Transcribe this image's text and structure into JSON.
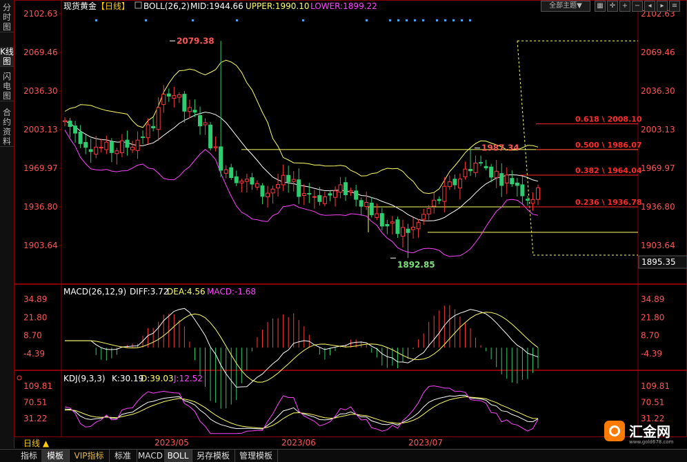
{
  "sidebar": {
    "tabs": [
      {
        "label": "分时图",
        "active": false
      },
      {
        "label": "K线图",
        "active": true
      },
      {
        "label": "闪电图",
        "active": false
      },
      {
        "label": "合约资料",
        "active": false
      }
    ]
  },
  "header": {
    "title": "现货黄金",
    "period": "【日线】",
    "boll_label": "BOLL(26,2)",
    "mid": "MID:1944.66",
    "upper": "UPPER:1990.10",
    "lower": "LOWER:1899.22",
    "theme_select": "全部主题▼"
  },
  "colors": {
    "up": "#ff3b3b",
    "down": "#2ecc71",
    "mid": "#ffffff",
    "upper": "#ffff66",
    "lower": "#ff44ff",
    "fib": "#ff2a2a",
    "support": "#ffff66",
    "axis_text": "#ff5555",
    "panel_border": "#8b0000"
  },
  "macd_header": {
    "label": "MACD(26,12,9)",
    "diff": "DIFF:3.72",
    "dea": "DEA:4.56",
    "macd": "MACD:-1.68"
  },
  "kdj_header": {
    "label": "KDJ(9,3,3)",
    "k": "K:30.19",
    "d": "D:39.03",
    "j": "J:12.52"
  },
  "bottom_tabs": [
    "指标",
    "模板",
    "VIP指标",
    "标准",
    "MACD",
    "BOLL",
    "另存模板",
    "管理模板"
  ],
  "bottom_period": "日线 ▲",
  "logo": {
    "text": "汇金网",
    "url": "www.gold678.com"
  },
  "chart_data": [
    {
      "type": "candlestick",
      "series_name": "现货黄金",
      "y_ticks": [
        2102.63,
        2069.46,
        2036.3,
        2003.13,
        1969.97,
        1936.8,
        1903.64
      ],
      "ylim": [
        1895.35,
        2102.63
      ],
      "x_labels": [
        "2023/05",
        "2023/06",
        "2023/07"
      ],
      "annotations": [
        {
          "text": "2079.38",
          "value": 2079.38,
          "type": "high"
        },
        {
          "text": "1892.85",
          "value": 1892.85,
          "type": "low"
        },
        {
          "text": "1987.34",
          "value": 1987.34,
          "type": "high"
        }
      ],
      "fib_levels": [
        {
          "text": "0.618 \\ 2008.10",
          "value": 2008.1
        },
        {
          "text": "0.500 \\ 1986.07",
          "value": 1986.07
        },
        {
          "text": "0.382 \\ 1964.04",
          "value": 1964.04
        },
        {
          "text": "0.236 \\ 1936.78",
          "value": 1936.78
        }
      ],
      "right_price_box": "1895.35",
      "boll": {
        "mid": 1944.66,
        "upper": 1990.1,
        "lower": 1899.22
      }
    },
    {
      "type": "line",
      "title": "MACD(26,12,9)",
      "y_ticks": [
        34.89,
        21.8,
        8.7,
        -4.39
      ],
      "series": [
        {
          "name": "DIFF",
          "last": 3.72
        },
        {
          "name": "DEA",
          "last": 4.56
        },
        {
          "name": "MACD",
          "last": -1.68
        }
      ]
    },
    {
      "type": "line",
      "title": "KDJ(9,3,3)",
      "y_ticks": [
        109.81,
        70.51,
        31.22
      ],
      "series": [
        {
          "name": "K",
          "last": 30.19
        },
        {
          "name": "D",
          "last": 39.03
        },
        {
          "name": "J",
          "last": 12.52
        }
      ]
    }
  ]
}
